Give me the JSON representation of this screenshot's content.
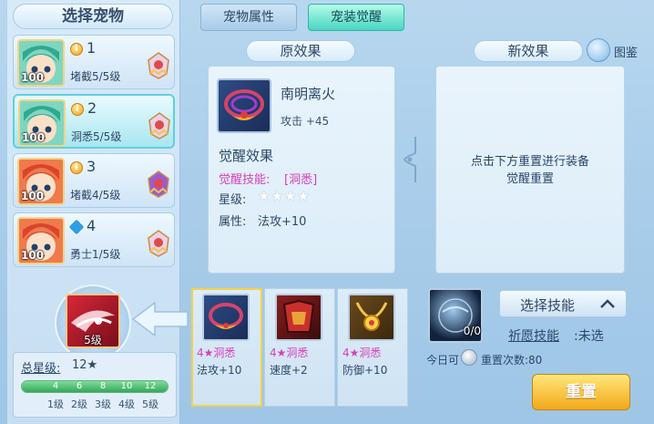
{
  "pet_panel": {
    "title": "选择宠物",
    "pets": [
      {
        "index": "1",
        "skill": "堵截5/5级",
        "level": "100",
        "badge": "gold-i-badge",
        "hair": "green"
      },
      {
        "index": "2",
        "skill": "洞悉5/5级",
        "level": "100",
        "badge": "gold-i-badge",
        "hair": "green"
      },
      {
        "index": "3",
        "skill": "堵截4/5级",
        "level": "100",
        "badge": "gold-i-badge",
        "hair": "red"
      },
      {
        "index": "4",
        "skill": "勇士1/5级",
        "level": "100",
        "badge": "blue-diamond-badge",
        "hair": "red"
      }
    ],
    "selected_index": 1
  },
  "pet_skill": {
    "level": "5级"
  },
  "star_total": {
    "label": "总星级:",
    "value": "12★",
    "star_ticks": [
      "4",
      "6",
      "8",
      "10",
      "12"
    ],
    "level_ticks": [
      "1级",
      "2级",
      "3级",
      "4级",
      "5级"
    ],
    "progress": 1.0
  },
  "tabs": {
    "pet_attributes": "宠物属性",
    "pet_equip_awaken": "宠装觉醒"
  },
  "original_effect": {
    "title": "原效果",
    "equip_name": "南明离火",
    "equip_stat": "攻击 +45",
    "awaken_title": "觉醒效果",
    "awaken_skill_label": "觉醒技能:",
    "awaken_skill_value": "[洞悉]",
    "star_label": "星级:",
    "star_value": "★★★★",
    "attr_label": "属性:",
    "attr_value": "法攻+10"
  },
  "new_effect": {
    "title": "新效果",
    "hint_line1": "点击下方重置进行装备",
    "hint_line2": "觉醒重置",
    "atlas_label": "图鉴"
  },
  "equip_slots": [
    {
      "skill": "4★洞悉",
      "stat": "法攻+10",
      "icon": "crown-icon"
    },
    {
      "skill": "4★洞悉",
      "stat": "速度+2",
      "icon": "armor-icon"
    },
    {
      "skill": "4★洞悉",
      "stat": "防御+10",
      "icon": "necklace-icon"
    }
  ],
  "reset_panel": {
    "item_count": "0/0",
    "select_skill_label": "选择技能",
    "wish_label": "祈愿技能",
    "wish_value": ":未选",
    "daily_label": "今日可",
    "daily_count": "重置次数:80",
    "reset_button": "重置"
  },
  "colors": {
    "accent_teal": "#49d6c2",
    "skill_pink": "#d63fb8",
    "reset_gold": "#f2a91b"
  }
}
